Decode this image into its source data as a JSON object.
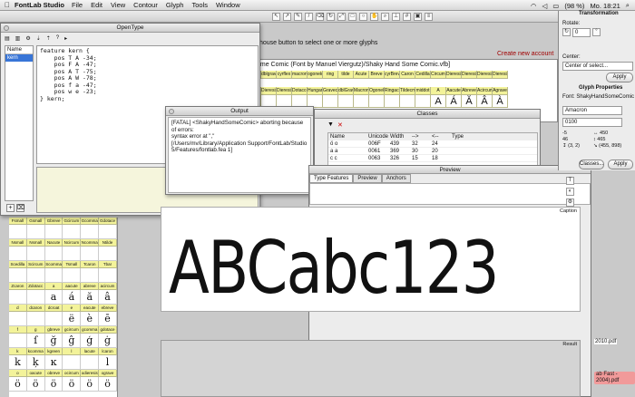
{
  "menubar": {
    "app_name": "FontLab Studio",
    "items": [
      "File",
      "Edit",
      "View",
      "Contour",
      "Glyph",
      "Tools",
      "Window"
    ],
    "battery": "(98 %)",
    "clock": "Mo. 18:21"
  },
  "background": {
    "status_text": "house button to select one or more glyphs",
    "font_title": "ome Comic (Font by Manuel Viergutz)/Shaky Hand Some Comic.vfb]",
    "new_account": "Create new account",
    "header_cells": [
      "ogravel",
      "dblgrave",
      "cyrflex",
      "macron",
      "ogonek",
      "ring",
      "tilde",
      "Acute",
      "Breve",
      "cyrBreve",
      "Caron",
      "Cedilla",
      "Circumflex",
      "Dieresis",
      "Dieresis",
      "Dieresis",
      "Dieresis"
    ],
    "row2_cells": [
      "Dieresis",
      "Dieresis",
      "Dieresis",
      "Dotacce",
      "Hungaru",
      "Gravecm",
      "dblGrave",
      "Macrong",
      "Ogonek",
      "Ringacu",
      "Tildecm",
      "middot",
      "A",
      "Aacute",
      "Abreve",
      "Acircum",
      "Agrave"
    ],
    "glyph_row": [
      "",
      "",
      "",
      "",
      "",
      "",
      "",
      "",
      "",
      "",
      "",
      "",
      "A",
      "Á",
      "Ă",
      "Â",
      "À"
    ]
  },
  "left_grid": {
    "rows": [
      [
        "Fsmall",
        "Gsmall",
        "Gbreve",
        "Gcircum",
        "Gcomma",
        "Gdotace"
      ],
      [
        "Nsmall",
        "Nsmall",
        "Nacute",
        "Ncircum",
        "Ncomma",
        "Ntilde"
      ],
      [
        "Scedilla",
        "Scircum",
        "Scomma",
        "Tsmall",
        "Tcaron",
        "Tbar"
      ],
      [
        "Zcaron",
        "Zdotacc",
        "a",
        "aacute",
        "abreve",
        "acircum"
      ],
      [
        "d",
        "dcaron",
        "dcroat",
        "e",
        "eacute",
        "ebreve"
      ],
      [
        "f",
        "g",
        "gbreve",
        "gcircum",
        "gcomma",
        "gdotace"
      ],
      [
        "k",
        "kcomma",
        "kgreen",
        "l",
        "lacute",
        "lcaron"
      ],
      [
        "o",
        "oacute",
        "obreve",
        "ocircum",
        "odieresis",
        "ograve"
      ]
    ],
    "glyphs": [
      [
        "",
        "",
        "",
        "",
        "",
        ""
      ],
      [
        "",
        "",
        "",
        "",
        "",
        ""
      ],
      [
        "",
        "",
        "",
        "",
        "",
        ""
      ],
      [
        "",
        "",
        "a",
        "á",
        "ă",
        "â"
      ],
      [
        "",
        "",
        "",
        "ë",
        "è",
        "ē"
      ],
      [
        "",
        "ſ",
        "ğ",
        "ĝ",
        "ģ",
        "ġ"
      ],
      [
        "k",
        "ķ",
        "ĸ",
        "",
        "",
        "l"
      ],
      [
        "ö",
        "ö",
        "ö",
        "ö",
        "ö",
        "ö"
      ]
    ]
  },
  "opentype": {
    "title": "OpenType",
    "list_header": "Name",
    "list_items": [
      "kern"
    ],
    "code_lines": [
      "feature kern {",
      "    pos T A -34;",
      "    pos F A -47;",
      "    pos A T -75;",
      "    pos A W -78;",
      "    pos f a -47;",
      "    pos w e -23;",
      "} kern;"
    ]
  },
  "output": {
    "title": "Output",
    "lines": [
      "[FATAL] <ShakyHandSomeComic> aborting because of errors:",
      "syntax error at \",\"",
      "[/Users/mv/Library/Application Support/FontLab/Studio 5/Features/fontlab.fea 1]"
    ]
  },
  "classes": {
    "title": "Classes",
    "columns": [
      "Name",
      "Unicode",
      "Width",
      "-->",
      "<--",
      "Type"
    ],
    "rows": [
      {
        "glyph": "ö",
        "name": "o",
        "unicode": "006F",
        "width": "439",
        "lsb": "32",
        "rsb": "24",
        "type": ""
      },
      {
        "glyph": "a",
        "name": "a",
        "unicode": "0061",
        "width": "369",
        "lsb": "30",
        "rsb": "20",
        "type": ""
      },
      {
        "glyph": "c",
        "name": "c",
        "unicode": "0063",
        "width": "326",
        "lsb": "15",
        "rsb": "18",
        "type": ""
      }
    ]
  },
  "preview": {
    "title": "Preview",
    "tabs": [
      "Type Features",
      "Preview",
      "Anchors"
    ],
    "caption_label": "Caption",
    "sample_text": "ABCabc123",
    "result_label": "Result"
  },
  "transform": {
    "title": "Transformation",
    "rotate_label": "Rotate:",
    "rotate_value": "0",
    "center_label": "Center:",
    "center_value": "Center of select...",
    "apply": "Apply"
  },
  "glyph_properties": {
    "title": "Glyph Properties",
    "font_label": "Font: ShakyHandSomeComic",
    "name_value": "Amacron",
    "unicode_value": "0100",
    "metrics": [
      "-5",
      "↔ 450",
      "46",
      "↕ 465",
      "↧ (3, 2)",
      "↘ (455, 898)"
    ],
    "classes": "Classes...",
    "apply": "Apply"
  },
  "desktop": {
    "pdf1": "2010.pdf",
    "pdf2": "ab Fast - 2004).pdf"
  }
}
